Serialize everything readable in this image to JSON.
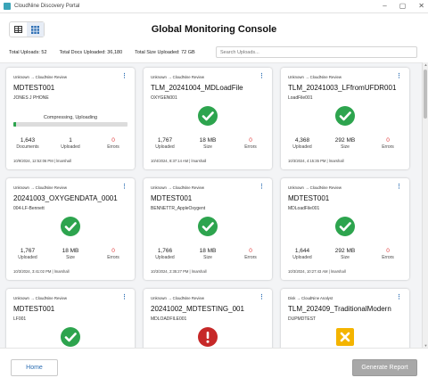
{
  "window": {
    "title": "CloudNine Discovery Portal",
    "controls": [
      "–",
      "▢",
      "✕"
    ]
  },
  "header": {
    "title": "Global Monitoring Console"
  },
  "stats": {
    "total_uploads": "Total Uploads: 52",
    "total_docs": "Total Docs Uploaded: 36,180",
    "total_size": "Total Size Uploaded: 72 GB"
  },
  "search": {
    "placeholder": "Search Uploads..."
  },
  "cards": [
    {
      "source": "Unknown → CloudNine Review",
      "name": "MDTEST001",
      "sub": "JONES J PHONE",
      "status": "in-progress",
      "progress_label": "Compressing, Uploading",
      "progress": 0.02,
      "metrics": [
        {
          "value": "1,643",
          "label": "Documents"
        },
        {
          "value": "1",
          "label": "Uploaded"
        },
        {
          "value": "0",
          "label": "Errors"
        }
      ],
      "footer": "10/9/2024, 12:52:06 PM | lmarshall"
    },
    {
      "source": "Unknown → CloudNine Review",
      "name": "TLM_20241004_MDLoadFile",
      "sub": "OXYGEN001",
      "status": "success",
      "metrics": [
        {
          "value": "1,767",
          "label": "Uploaded"
        },
        {
          "value": "18 MB",
          "label": "Size"
        },
        {
          "value": "0",
          "label": "Errors"
        }
      ],
      "footer": "10/4/2024, 8:37:14 AM | lmarshall"
    },
    {
      "source": "Unknown → CloudNine Review",
      "name": "TLM_20241003_LFfromUFDR001",
      "sub": "LoadFile001",
      "status": "success",
      "metrics": [
        {
          "value": "4,368",
          "label": "Uploaded"
        },
        {
          "value": "292 MB",
          "label": "Size"
        },
        {
          "value": "0",
          "label": "Errors"
        }
      ],
      "footer": "10/3/2024, 4:15:35 PM | lmarshall"
    },
    {
      "source": "Unknown → CloudNine Review",
      "name": "20241003_OXYGENDATA_0001",
      "sub": "004-LF-Bennett",
      "status": "success",
      "metrics": [
        {
          "value": "1,767",
          "label": "Uploaded"
        },
        {
          "value": "18 MB",
          "label": "Size"
        },
        {
          "value": "0",
          "label": "Errors"
        }
      ],
      "footer": "10/3/2024, 3:41:02 PM | lmarshall"
    },
    {
      "source": "Unknown → CloudNine Review",
      "name": "MDTEST001",
      "sub": "BENNETTR_AppleOxygent",
      "status": "success",
      "metrics": [
        {
          "value": "1,766",
          "label": "Uploaded"
        },
        {
          "value": "18 MB",
          "label": "Size"
        },
        {
          "value": "0",
          "label": "Errors"
        }
      ],
      "footer": "10/3/2024, 2:35:27 PM | lmarshall"
    },
    {
      "source": "Unknown → CloudNine Review",
      "name": "MDTEST001",
      "sub": "MDLoadFile001",
      "status": "success",
      "metrics": [
        {
          "value": "1,644",
          "label": "Uploaded"
        },
        {
          "value": "292 MB",
          "label": "Size"
        },
        {
          "value": "0",
          "label": "Errors"
        }
      ],
      "footer": "10/3/2024, 10:27:43 AM | lmarshall"
    },
    {
      "source": "Unknown → CloudNine Review",
      "name": "MDTEST001",
      "sub": "LF001",
      "status": "success"
    },
    {
      "source": "Unknown → CloudNine Review",
      "name": "20241002_MDTESTING_001",
      "sub": "MDLOADFILE001",
      "status": "error"
    },
    {
      "source": "Disk → CloudNine Analyst",
      "name": "TLM_202409_TraditionalModern",
      "sub": "DUPMDTEST",
      "status": "cancelled"
    }
  ],
  "footer": {
    "home_label": "Home",
    "report_label": "Generate Report"
  },
  "colors": {
    "success": "#2da44e",
    "error": "#c62828",
    "cancelled": "#f4b400",
    "accent": "#2d6fb3"
  }
}
